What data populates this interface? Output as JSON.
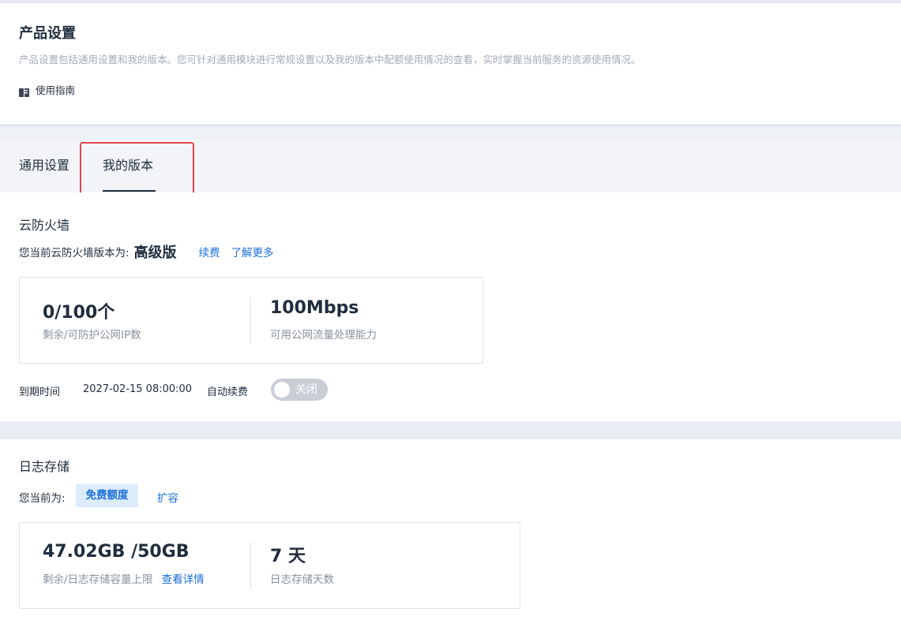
{
  "header": {
    "title": "产品设置",
    "description": "产品设置包括通用设置和我的版本。您可针对通用模块进行常规设置以及我的版本中配额使用情况的查看，实时掌握当前服务的资源使用情况。",
    "guide_label": "使用指南"
  },
  "tabs": [
    {
      "label": "通用设置",
      "active": false
    },
    {
      "label": "我的版本",
      "active": true
    }
  ],
  "firewall": {
    "title": "云防火墙",
    "current_version_label": "您当前云防火墙版本为:",
    "edition": "高级版",
    "renew_link": "续费",
    "learn_more_link": "了解更多",
    "stats": [
      {
        "value": "0/100个",
        "label": "剩余/可防护公网IP数"
      },
      {
        "value": "100Mbps",
        "label": "可用公网流量处理能力"
      }
    ],
    "expiry_label": "到期时间",
    "expiry_value": "2027-02-15 08:00:00",
    "auto_renew_label": "自动续费",
    "auto_renew_state": "关闭"
  },
  "log_storage": {
    "title": "日志存储",
    "current_label": "您当前为:",
    "badge": "免费额度",
    "expand_link": "扩容",
    "stats": [
      {
        "value": "47.02GB /50GB",
        "label": "剩余/日志存储容量上限",
        "link": "查看详情"
      },
      {
        "value": "7 天",
        "label": "日志存储天数"
      }
    ]
  },
  "colors": {
    "accent": "#1a6fd6",
    "highlight_box": "#e0464b",
    "text": "#1f2d3d",
    "muted": "#8a93a0"
  }
}
